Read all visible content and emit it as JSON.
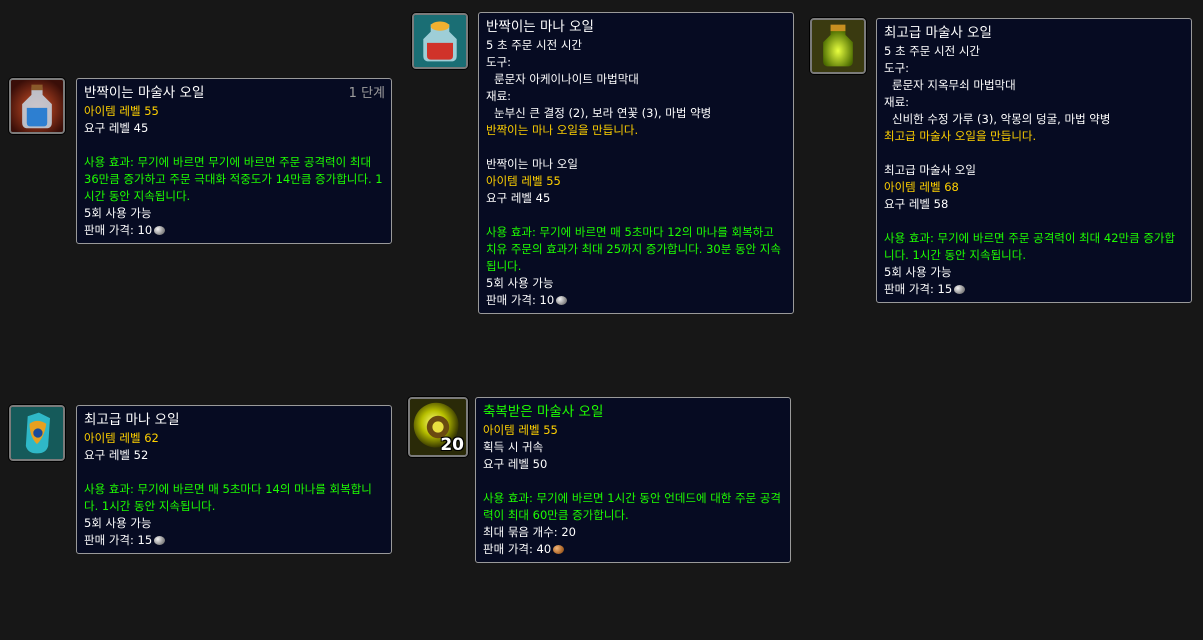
{
  "items": [
    {
      "title": "반짝이는 마술사 오일",
      "rank": "1 단계",
      "item_level": "아이템 레벨 55",
      "req_level": "요구 레벨 45",
      "use": "사용 효과: 무기에 바르면 무기에 바르면 주문 공격력이 최대 36만큼 증가하고 주문 극대화 적중도가 14만큼 증가합니다. 1시간 동안 지속됩니다.",
      "charges": "5회 사용 가능",
      "sell_label": "판매 가격: 10"
    },
    {
      "title": "반짝이는 마나 오일",
      "cast_time": "5 초 주문 시전 시간",
      "tools_label": "도구:",
      "tools": "룬문자 아케이나이트 마법막대",
      "reagents_label": "재료:",
      "reagents": "눈부신 큰 결정 (2), 보라 연꽃 (3), 마법 약병",
      "creates": "반짝이는 마나 오일을 만듭니다.",
      "sub_title": "반짝이는 마나 오일",
      "item_level": "아이템 레벨 55",
      "req_level": "요구 레벨 45",
      "use": "사용 효과: 무기에 바르면 매 5초마다 12의 마나를 회복하고 치유 주문의 효과가 최대 25까지 증가합니다. 30분 동안 지속됩니다.",
      "charges": "5회 사용 가능",
      "sell_label": "판매 가격: 10"
    },
    {
      "title": "최고급 마술사 오일",
      "cast_time": "5 초 주문 시전 시간",
      "tools_label": "도구:",
      "tools": "룬문자 지옥무쇠 마법막대",
      "reagents_label": "재료:",
      "reagents": "신비한 수정 가루 (3), 악몽의 덩굴, 마법 약병",
      "creates": "최고급 마술사 오일을 만듭니다.",
      "sub_title": "최고급 마술사 오일",
      "item_level": "아이템 레벨 68",
      "req_level": "요구 레벨 58",
      "use": "사용 효과: 무기에 바르면 주문 공격력이 최대 42만큼 증가합니다. 1시간 동안 지속됩니다.",
      "charges": "5회 사용 가능",
      "sell_label": "판매 가격: 15"
    },
    {
      "title": "최고급 마나 오일",
      "item_level": "아이템 레벨 62",
      "req_level": "요구 레벨 52",
      "use": "사용 효과: 무기에 바르면 매 5초마다 14의 마나를 회복합니다. 1시간 동안 지속됩니다.",
      "charges": "5회 사용 가능",
      "sell_label": "판매 가격: 15"
    },
    {
      "title": "축복받은 마술사 오일",
      "item_level": "아이템 레벨 55",
      "bind": "획득 시 귀속",
      "req_level": "요구 레벨 50",
      "use": "사용 효과: 무기에 바르면 1시간 동안 언데드에 대한 주문 공격력이 최대 60만큼 증가합니다.",
      "stack_label": "최대 묶음 개수: 20",
      "sell_label": "판매 가격: 40",
      "stack_count": "20"
    }
  ],
  "icons": [
    "wizard-oil-icon",
    "mana-oil-icon",
    "superior-wizard-oil-icon",
    "superior-mana-oil-icon",
    "blessed-wizard-oil-icon"
  ],
  "colors": {
    "quality_white": "#ffffff",
    "item_level": "#ffd100",
    "use_effect": "#1eff00",
    "tooltip_bg": "#060b22"
  }
}
